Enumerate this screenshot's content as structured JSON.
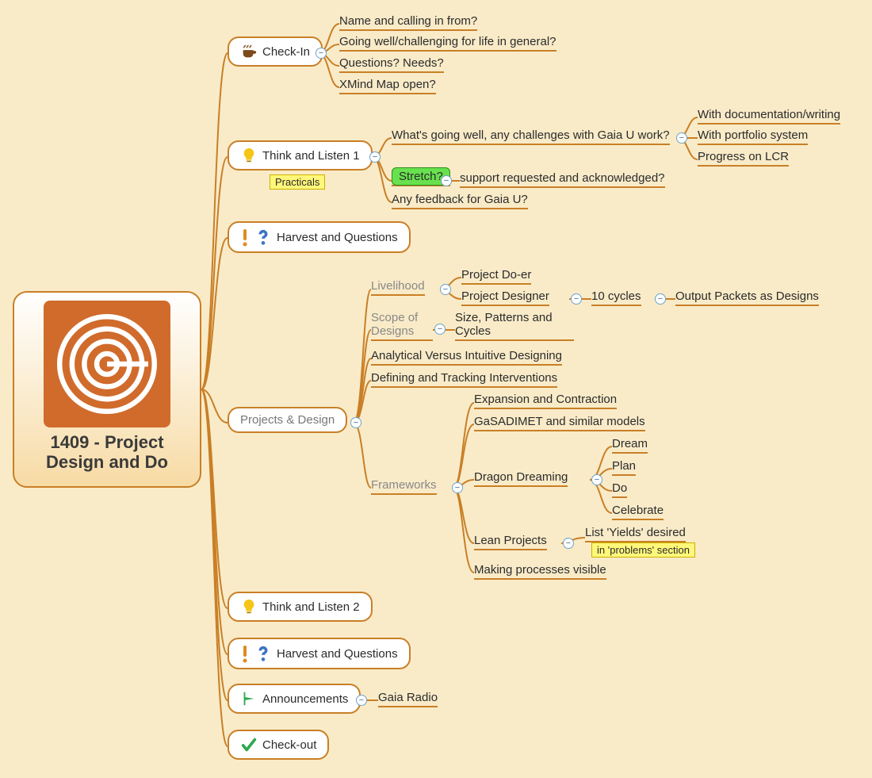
{
  "root": {
    "title": "1409 - Project Design and Do"
  },
  "checkin": {
    "label": "Check-In",
    "q1": "Name and calling in from?",
    "q2": "Going well/challenging for life in general?",
    "q3": "Questions? Needs?",
    "q4": "XMind Map open?"
  },
  "tl1": {
    "label": "Think and Listen 1",
    "tag": "Practicals",
    "a": "What's going well, any challenges with Gaia U work?",
    "a1": "With documentation/writing",
    "a2": "With portfolio system",
    "a3": "Progress on LCR",
    "b": "Stretch?",
    "b1": "support requested and acknowledged?",
    "c": "Any feedback for Gaia U?"
  },
  "hq": {
    "label": "Harvest and Questions"
  },
  "projects": {
    "label": "Projects & Design",
    "livelihood": "Livelihood",
    "liv_a": "Project Do-er",
    "liv_b": "Project Designer",
    "liv_b1": "10 cycles",
    "liv_b2": "Output Packets as Designs",
    "scope": "Scope of Designs",
    "scope_a": "Size, Patterns and Cycles",
    "analytic": "Analytical Versus Intuitive Designing",
    "define": "Defining and Tracking Interventions",
    "frameworks": "Frameworks",
    "fw_a": "Expansion and Contraction",
    "fw_b": "GaSADIMET and similar models",
    "fw_c": "Dragon Dreaming",
    "fw_c1": "Dream",
    "fw_c2": "Plan",
    "fw_c3": "Do",
    "fw_c4": "Celebrate",
    "fw_d": "Lean Projects",
    "fw_d1": "List 'Yields' desired",
    "fw_d1_tag": "in 'problems' section",
    "fw_e": "Making processes visible"
  },
  "tl2": {
    "label": "Think and Listen 2"
  },
  "hq2": {
    "label": "Harvest and Questions"
  },
  "ann": {
    "label": "Announcements",
    "a": "Gaia Radio"
  },
  "out": {
    "label": "Check-out"
  },
  "btn": {
    "minus": "−"
  }
}
